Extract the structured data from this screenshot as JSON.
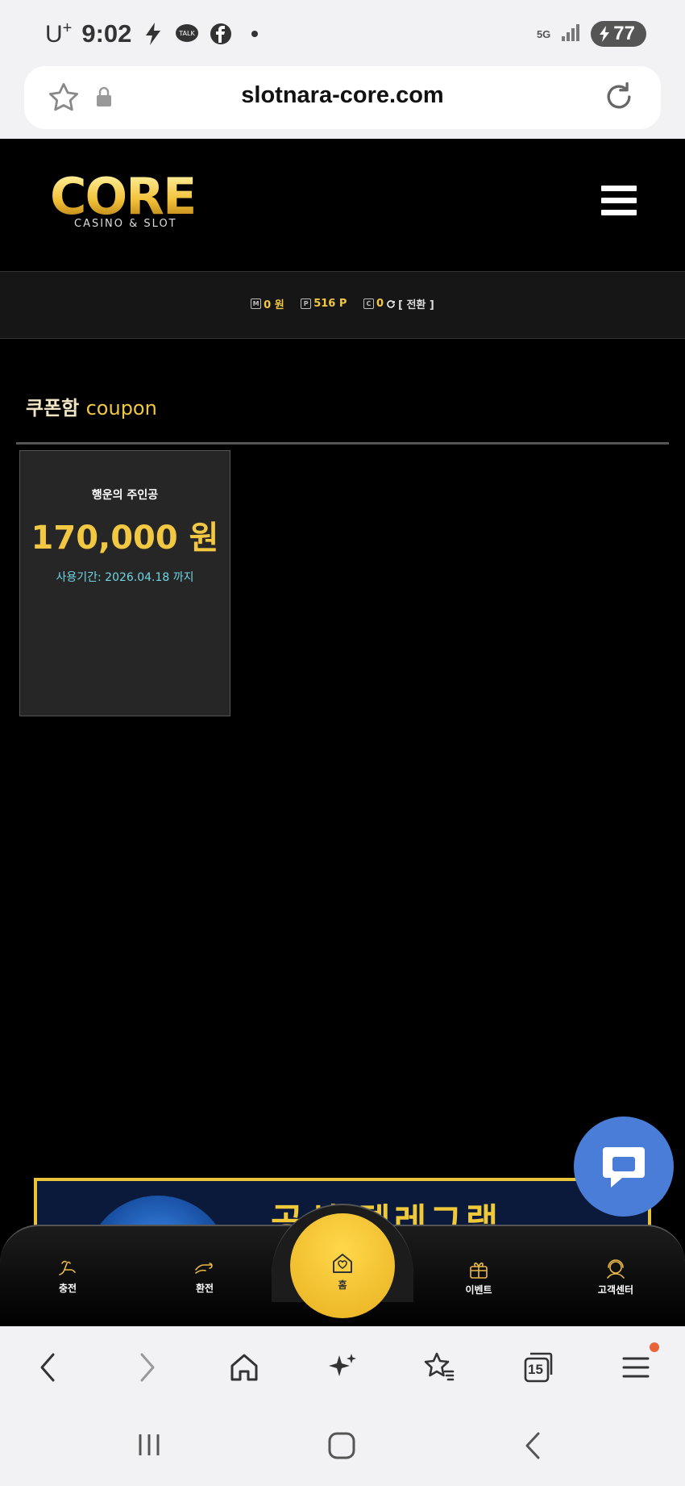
{
  "status_bar": {
    "carrier": "U",
    "carrier_sup": "+",
    "time": "9:02",
    "network": "5G",
    "battery": "77"
  },
  "browser": {
    "url": "slotnara-core.com",
    "tab_count": "15"
  },
  "site": {
    "logo_text": "CORE",
    "logo_sub": "CASINO & SLOT",
    "balance": {
      "money_value": "0 원",
      "points_value": "516 P",
      "casino_value": "0",
      "convert_label": "[ 전환 ]"
    }
  },
  "section": {
    "title_ko": "쿠폰함",
    "title_en": "coupon"
  },
  "coupon": {
    "name": "행운의 주인공",
    "amount": "170,000 원",
    "expiry": "사용기간: 2026.04.18 까지"
  },
  "banner": {
    "text": "공식 텔레그램"
  },
  "bottom_nav": {
    "charge": "충전",
    "exchange": "환전",
    "home": "홈",
    "event": "이벤트",
    "support": "고객센터"
  },
  "colors": {
    "accent_gold": "#f2c843",
    "expiry_cyan": "#6fd6e4",
    "chat_blue": "#4a7dd8"
  },
  "icons": [
    "star-icon",
    "lock-icon",
    "reload-icon",
    "hamburger-icon",
    "chat-icon",
    "home-icon",
    "back-icon",
    "forward-icon",
    "sparkle-icon",
    "bookmark-icon",
    "tabs-icon",
    "menu-icon"
  ]
}
